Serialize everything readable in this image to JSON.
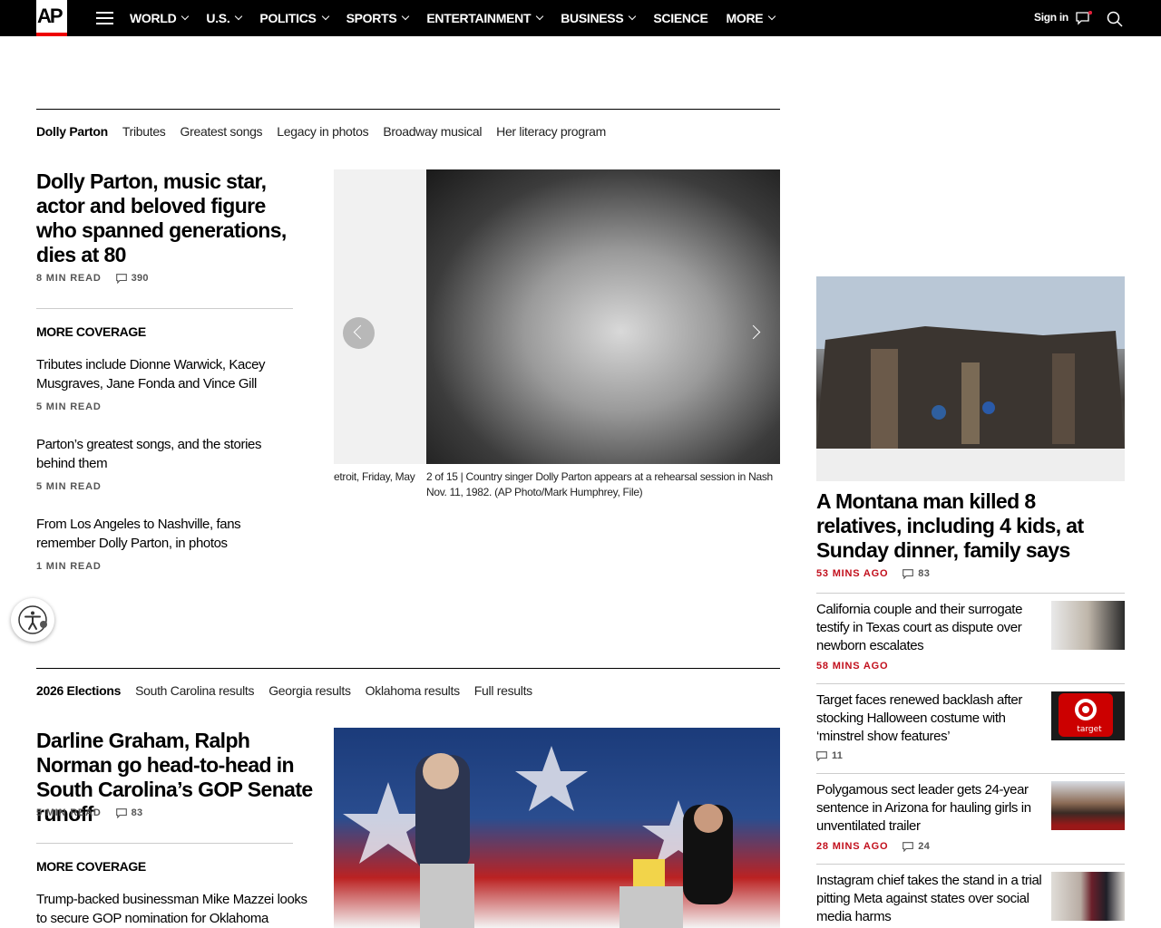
{
  "nav": {
    "logo": "AP",
    "items": [
      {
        "label": "WORLD",
        "dropdown": true
      },
      {
        "label": "U.S.",
        "dropdown": true
      },
      {
        "label": "POLITICS",
        "dropdown": true
      },
      {
        "label": "SPORTS",
        "dropdown": true
      },
      {
        "label": "ENTERTAINMENT",
        "dropdown": true
      },
      {
        "label": "BUSINESS",
        "dropdown": true
      },
      {
        "label": "SCIENCE",
        "dropdown": false
      },
      {
        "label": "MORE",
        "dropdown": true
      }
    ],
    "signin": "Sign in"
  },
  "section1": {
    "subnav": [
      "Dolly Parton",
      "Tributes",
      "Greatest songs",
      "Legacy in photos",
      "Broadway musical",
      "Her literacy program"
    ],
    "headline": "Dolly Parton, music star, actor and beloved figure who spanned generations, dies at 80",
    "read_time": "8 MIN READ",
    "comments": "390",
    "more_coverage_label": "MORE COVERAGE",
    "coverage": [
      {
        "title": "Tributes include Dionne Warwick, Kacey Musgraves, Jane Fonda and Vince Gill",
        "read_time": "5 MIN READ"
      },
      {
        "title": "Parton’s greatest songs, and the stories behind them",
        "read_time": "5 MIN READ"
      },
      {
        "title": "From Los Angeles to Nashville, fans remember Dolly Parton, in photos",
        "read_time": "1 MIN READ"
      }
    ],
    "gallery": {
      "prev_caption": "etroit, Friday, May",
      "counter": "2 of 15",
      "caption_line1": "Country singer Dolly Parton appears at a rehearsal session in Nash",
      "caption_line2": "Nov. 11, 1982. (AP Photo/Mark Humphrey, File)"
    }
  },
  "section2": {
    "subnav": [
      "2026 Elections",
      "South Carolina results",
      "Georgia results",
      "Oklahoma results",
      "Full results"
    ],
    "headline": "Darline Graham, Ralph Norman go head-to-head in South Carolina’s GOP Senate runoff",
    "read_time": "5 MIN READ",
    "comments": "83",
    "more_coverage_label": "MORE COVERAGE",
    "coverage": [
      {
        "title": "Trump-backed businessman Mike Mazzei looks to secure GOP nomination for Oklahoma"
      }
    ]
  },
  "rail": {
    "lead": {
      "title": "A Montana man killed 8 relatives, including 4 kids, at Sunday dinner, family says",
      "time": "53 MINS AGO",
      "comments": "83"
    },
    "items": [
      {
        "title": "California couple and their surrogate testify in Texas court as dispute over newborn escalates",
        "time": "58 MINS AGO",
        "comments": ""
      },
      {
        "title": "Target faces renewed backlash after stocking Halloween costume with ‘minstrel show features’",
        "time": "",
        "comments": "11",
        "thumb_text": "target"
      },
      {
        "title": "Polygamous sect leader gets 24-year sentence in Arizona for hauling girls in unventilated trailer",
        "time": "28 MINS AGO",
        "comments": "24"
      },
      {
        "title": "Instagram chief takes the stand in a trial pitting Meta against states over social media harms",
        "time": "",
        "comments": ""
      }
    ]
  },
  "colors": {
    "accent": "#c20f1c",
    "nav_bg": "#000000"
  }
}
